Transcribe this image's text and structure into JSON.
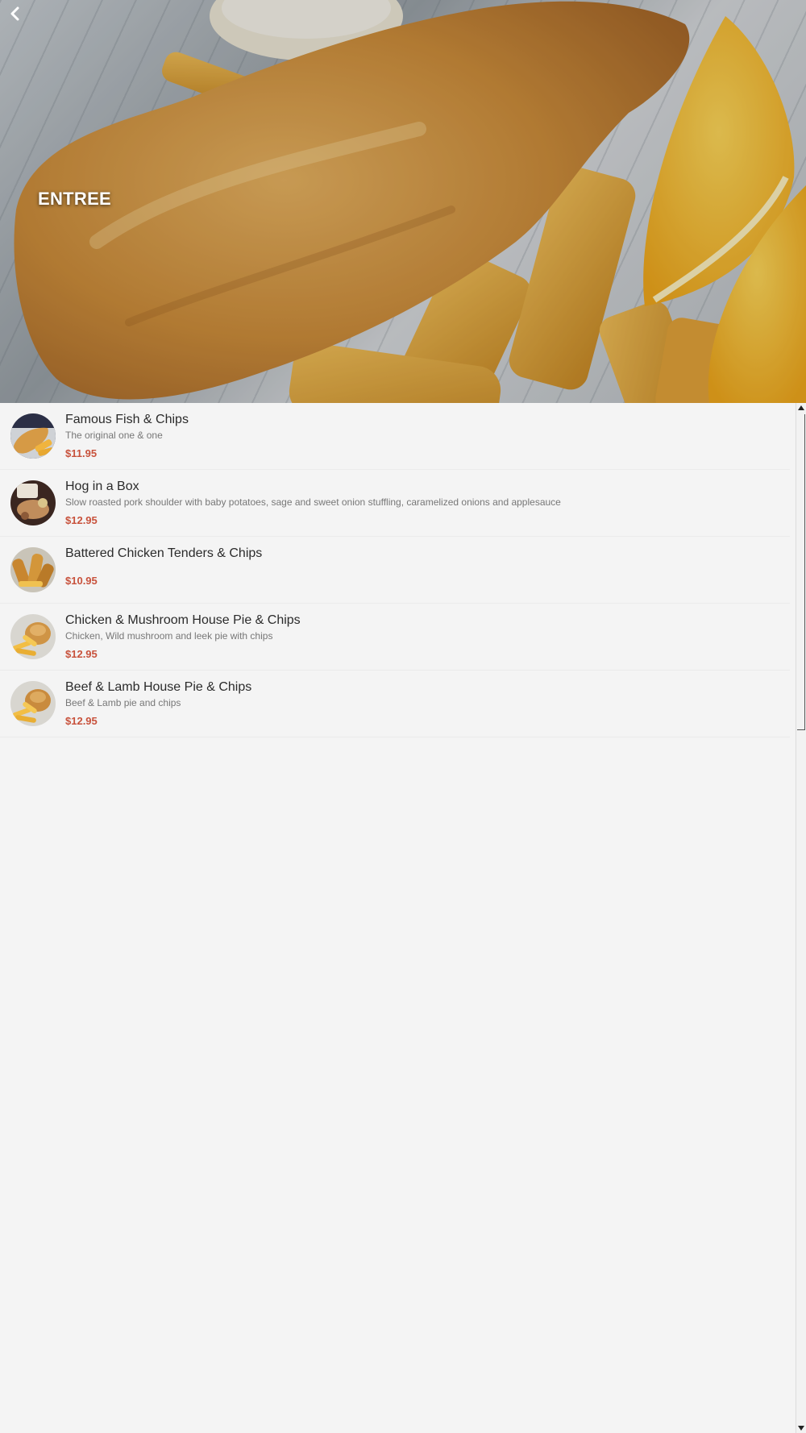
{
  "header": {
    "title": "ENTREE",
    "back_icon": "chevron-left-icon"
  },
  "colors": {
    "price": "#c8523c",
    "background": "#f4f4f4"
  },
  "items": [
    {
      "name": "Famous Fish & Chips",
      "description": "The original one & one",
      "price": "$11.95"
    },
    {
      "name": "Hog in a Box",
      "description": "Slow roasted pork shoulder with baby potatoes, sage and sweet onion stuffling, caramelized onions and applesauce",
      "price": "$12.95"
    },
    {
      "name": "Battered Chicken Tenders & Chips",
      "description": "",
      "price": "$10.95"
    },
    {
      "name": "Chicken & Mushroom House Pie & Chips",
      "description": "Chicken, Wild mushroom and leek pie with chips",
      "price": "$12.95"
    },
    {
      "name": "Beef & Lamb House Pie & Chips",
      "description": "Beef & Lamb pie and chips",
      "price": "$12.95"
    }
  ]
}
